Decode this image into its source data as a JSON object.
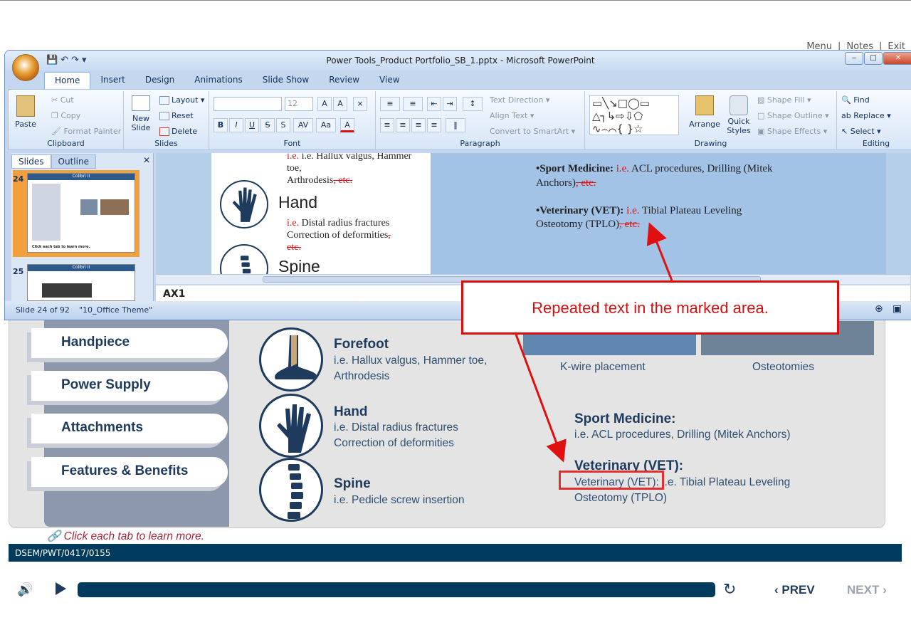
{
  "top_menu": {
    "menu": "Menu",
    "notes": "Notes",
    "exit": "Exit"
  },
  "course": {
    "tabs": [
      "Handpiece",
      "Power Supply",
      "Attachments",
      "Features & Benefits"
    ],
    "clinical": [
      {
        "title": "Forefoot",
        "desc1": "i.e. Hallux valgus, Hammer toe,",
        "desc2": "Arthrodesis",
        "icon": "foot-icon"
      },
      {
        "title": "Hand",
        "desc1": "i.e. Distal radius fractures",
        "desc2": "Correction of deformities",
        "icon": "hand-icon"
      },
      {
        "title": "Spine",
        "desc1": "i.e. Pedicle screw insertion",
        "desc2": "",
        "icon": "spine-icon"
      }
    ],
    "photo_captions": [
      "K-wire placement",
      "Osteotomies"
    ],
    "sport_title": "Sport Medicine:",
    "sport_desc": "i.e. ACL procedures, Drilling (Mitek Anchors)",
    "vet_title": "Veterinary (VET):",
    "vet_desc_1": "Veterinary (VET): i.e. Tibial Plateau Leveling",
    "vet_desc_2": "Osteotomy (TPLO)",
    "hint": "Click each tab to learn more.",
    "footer_code": "DSEM/PWT/0417/0155",
    "prev": "PREV",
    "next": "NEXT"
  },
  "ppt": {
    "title": "Power Tools_Product Portfolio_SB_1.pptx - Microsoft PowerPoint",
    "ribbon_tabs": [
      "Home",
      "Insert",
      "Design",
      "Animations",
      "Slide Show",
      "Review",
      "View"
    ],
    "clipboard": {
      "paste": "Paste",
      "cut": "Cut",
      "copy": "Copy",
      "format_painter": "Format Painter",
      "label": "Clipboard"
    },
    "slides_group": {
      "new_slide_1": "New",
      "new_slide_2": "Slide",
      "layout": "Layout",
      "reset": "Reset",
      "delete": "Delete",
      "label": "Slides"
    },
    "font_group": {
      "size": "12",
      "label": "Font"
    },
    "paragraph_group": {
      "text_direction": "Text Direction",
      "align_text": "Align Text",
      "convert_smartart": "Convert to SmartArt",
      "label": "Paragraph"
    },
    "drawing_group": {
      "arrange": "Arrange",
      "quick_styles_1": "Quick",
      "quick_styles_2": "Styles",
      "shape_fill": "Shape Fill",
      "shape_outline": "Shape Outline",
      "shape_effects": "Shape Effects",
      "label": "Drawing"
    },
    "editing_group": {
      "find": "Find",
      "replace": "Replace",
      "select": "Select",
      "label": "Editing"
    },
    "pane_tabs": [
      "Slides",
      "Outline"
    ],
    "thumbs": [
      {
        "num": "24",
        "title": "Colibri II",
        "footer": "Click each tab to learn more."
      },
      {
        "num": "25",
        "title": "Colibri II"
      }
    ],
    "slide": {
      "left_line1": "i.e. Hallux valgus, Hammer",
      "left_line2": "toe,",
      "left_line3": "Arthrodesis",
      "left_etc": ", etc.",
      "hand_title": "Hand",
      "hand_ie": "i.e.",
      "hand_line1": " Distal radius fractures",
      "hand_line2": "Correction of deformities",
      "hand_etc_comma": ",",
      "hand_etc": "etc.",
      "spine_title": "Spine",
      "sport_bold": "•Sport Medicine:",
      "sport_ie": " i.e.",
      "sport_rest": " ACL procedures, Drilling  (Mitek",
      "sport_rest2": "Anchors)",
      "sport_etc": ", etc.",
      "vet_bold": "•Veterinary (VET):",
      "vet_ie": " i.e.",
      "vet_rest": " Tibial  Plateau Leveling",
      "vet_rest2": "Osteotomy (TPLO)",
      "vet_etc": ", etc."
    },
    "notes_text": "AX1",
    "status_slide": "Slide 24 of 92",
    "status_theme": "\"10_Office Theme\""
  },
  "callout": {
    "text": "Repeated text in the marked area.",
    "color": "#d80f0f"
  }
}
